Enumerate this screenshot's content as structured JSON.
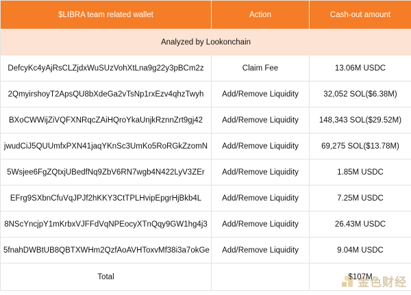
{
  "table": {
    "headers": {
      "wallet": "$LIBRA team related wallet",
      "action": "Action",
      "amount": "Cash-out amount"
    },
    "subtitle": "Analyzed by Lookonchain",
    "rows": [
      {
        "wallet": "DefcyKc4yAjRsCLZjdxWuSUzVohXtLna9g22y3pBCm2z",
        "action": "Claim Fee",
        "amount": "13.06M USDC"
      },
      {
        "wallet": "2QmyirshoyT2ApsQU8bXdeGa2vTsNp1rxEzv4qhzTwyh",
        "action": "Add/Remove Liquidity",
        "amount": "32,052 SOL($6.38M)"
      },
      {
        "wallet": "BXoCWWijZiVQFXNRqcZAiHQroYkaUnjkRznnZrt9gj42",
        "action": "Add/Remove Liquidity",
        "amount": "148,343 SOL($29.52M)"
      },
      {
        "wallet": "jwudCiJ5QUUmfxPXN41jaqYKnSc3UmKo5RoRGkZzomN",
        "action": "Add/Remove Liquidity",
        "amount": "69,275 SOL($13.78M)"
      },
      {
        "wallet": "5Wsjee6FgZQtxjUBedfNq9ZbV6RN7wgb4N422LyV3ZEr",
        "action": "Add/Remove Liquidity",
        "amount": "1.85M USDC"
      },
      {
        "wallet": "EFrg9SXbnCfuVqJPJf2hKKY3CtTPLHvipEpgrHjBkb4L",
        "action": "Add/Remove Liquidity",
        "amount": "7.25M USDC"
      },
      {
        "wallet": "8NScYncjpY1mKrbxVJFFdVqNPEocyXTnQqy9GW1hg4j3",
        "action": "Add/Remove Liquidity",
        "amount": "26.43M USDC"
      },
      {
        "wallet": "5fnahDWBtUB8QBTXWHm2QzfAoAVHToxvMf38i3a7okGe",
        "action": "Add/Remove Liquidity",
        "amount": "9.04M USDC"
      }
    ],
    "total_label": "Total",
    "total_amount": "$107M"
  },
  "watermark": {
    "text": "金色财经",
    "icon": "gold-logo-icon"
  },
  "colors": {
    "header_bg": "#f57d28",
    "subtitle_bg": "#fde3d3",
    "border": "#e3e3e3"
  }
}
